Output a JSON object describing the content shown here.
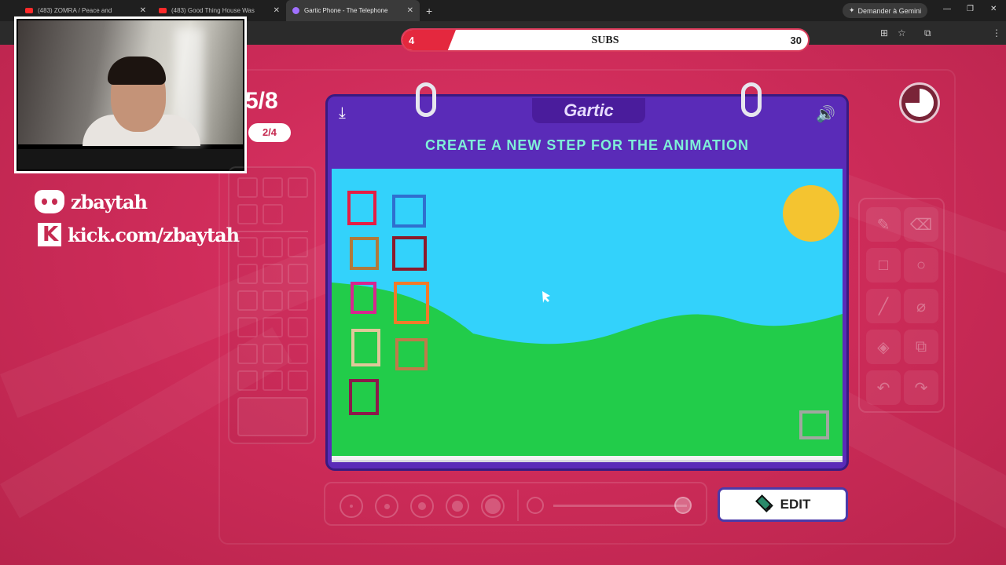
{
  "browser": {
    "tabs": [
      {
        "title": "(483) ZOMRA / Peace and",
        "active": false
      },
      {
        "title": "(483) Good Thing House Was",
        "active": false
      },
      {
        "title": "Gartic Phone - The Telephone",
        "active": true
      }
    ],
    "gemini_button": "Demander à Gemini"
  },
  "subs_bar": {
    "current": "4",
    "label": "SUBS",
    "goal": "30",
    "progress": 0.13
  },
  "socials": {
    "discord": "zbaytah",
    "kick": "kick.com/zbaytah"
  },
  "round": {
    "main": "5/8",
    "sub": "2/4"
  },
  "notebook": {
    "logo": "Gartic",
    "prompt": "CREATE A NEW STEP FOR THE ANIMATION"
  },
  "edit_button": {
    "label": "EDIT"
  },
  "timer": {
    "remaining_fraction": 0.75
  },
  "colors": {
    "background": "#c52a50",
    "notebook": "#5a2bb8",
    "sky": "#33d2fb",
    "grass": "#22cc4a",
    "sun": "#f4c430",
    "prompt": "#7ff0d8"
  },
  "canvas_squares": [
    "red",
    "blue",
    "brown",
    "dark-red",
    "magenta",
    "orange",
    "beige",
    "terracotta",
    "dark-magenta",
    "gray"
  ],
  "tools": [
    "pencil-icon",
    "eraser-icon",
    "rectangle-icon",
    "circle-icon",
    "line-icon",
    "eyedropper-icon",
    "fill-icon",
    "layers-icon",
    "undo-icon",
    "redo-icon"
  ]
}
